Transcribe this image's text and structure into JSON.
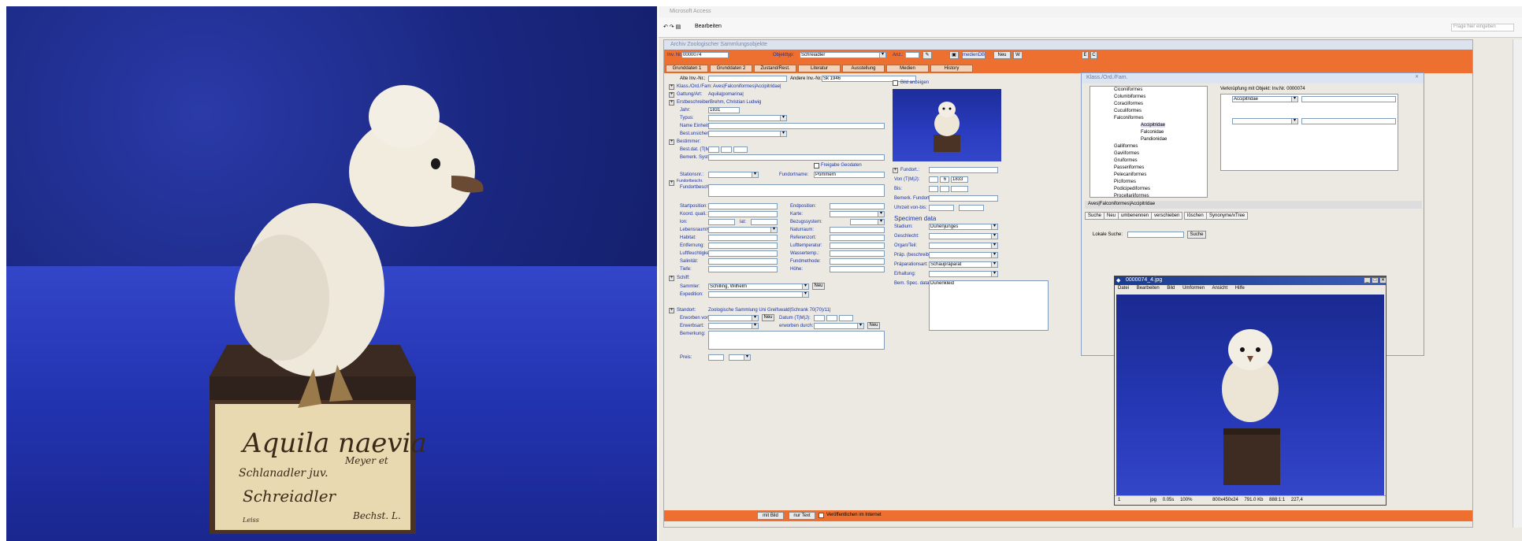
{
  "left_photo": {
    "label_line1": "Aquila naevia",
    "label_line2": "Meyer et",
    "label_line3": "Schlanadler juv.",
    "label_line4": "Schreiadler",
    "label_line5": "Leiss",
    "label_line6": "Bechst. L."
  },
  "app": {
    "title": "Microsoft Access",
    "ribbon_label": "Bearbeiten",
    "help_search": "Frage hier eingeben",
    "form_title": "Archiv Zoologischer Sammlungsobjekte",
    "header": {
      "inv_label": "Inv. Nr.:",
      "inv_value": "0000074",
      "objekttyp_label": "Objekttyp:",
      "objekttyp_value": "Schreiadler",
      "anz_label": "Anz.:",
      "medien_btn": "medienDB",
      "neu_btn": "Neu",
      "small_btn": "W",
      "e_btn": "E",
      "c_btn": "C"
    },
    "tabs": [
      "Grunddaten 1",
      "Grunddaten 2",
      "Zustand/Rest.",
      "Literatur",
      "Ausstellung",
      "Medien",
      "History"
    ],
    "fields": {
      "alte_inv": "Alte Inv.-Nr.:",
      "andere_inv": "Andere Inv.-Nr.:",
      "andere_inv_value": "Sk 1946",
      "klass": "Klass./Ord./Fam:",
      "klass_value": "Aves|Falconiformes|Accipitridae|",
      "gattung": "Gattung/Art:",
      "gattung_value": "Aquila|pomarina|",
      "erstbeschreiber": "Erstbeschreiber:",
      "erstbeschreiber_value": "Brehm, Christian Ludwig",
      "jahr": "Jahr:",
      "jahr_value": "1831",
      "typus": "Typus:",
      "name_einheit": "Name Einheit:",
      "best_unsicher": "Best.unsicher:",
      "bestimmer": "Bestimmer:",
      "best_dat": "Best.dat. (T|M|J):",
      "bemerk_syst": "Bemerk. Syst.:",
      "freigabe": "Freigabe Geodaten",
      "stationsnr": "Stationsnr.:",
      "fundortname": "Fundortname:",
      "fundortname_value": "Pommern",
      "fundortbeschr": "Fundortbeschr.:",
      "fundortbeschr_head": "Fundortbeschr.",
      "startposition": "Startposition:",
      "endposition": "Endposition:",
      "koord": "Koord. quali.:",
      "karte": "Karte:",
      "lon": "lon:",
      "lat": "lat:",
      "bezugssystem": "Bezugssystem:",
      "lebensraum": "Lebensraumtyp:",
      "naturraum": "Naturraum:",
      "habitat": "Habitat:",
      "referenzort": "Referenzort:",
      "entfernung": "Entfernung:",
      "lufttemp": "Lufttemperatur:",
      "luftfeuchte": "Luftfeuchtigkeit:",
      "wassertemp": "Wassertemp.:",
      "salinitaet": "Salinität:",
      "fundmethode": "Fundmethode:",
      "tiefe": "Tiefe:",
      "hoehe": "Höhe:",
      "schiff": "Schiff:",
      "sammler": "Sammler:",
      "sammler_value": "Schilling, Wilhelm",
      "expedition": "Expedition:",
      "standort": "Standort:",
      "standort_value": "Zoologische Sammlung Uni Greifswald|Schrank 70(70)/11|",
      "erworben_von": "Erworben von:",
      "datum": "Datum (T|M|J):",
      "erwerbsart": "Erwerbsart:",
      "erworben_durch": "erworben durch:",
      "bemerkung": "Bemerkung:",
      "preis": "Preis:",
      "neu": "Neu",
      "bild_anzeigen": "Bild anzeigen",
      "fundort": "Fundort.:",
      "von": "Von (T|M|J):",
      "von_m": "6",
      "von_j": "1833",
      "bis": "Bis:",
      "bemerk_fundort": "Bemerk. Fundort.:",
      "uhrzeit": "Uhrzeit von-bis:",
      "specimen_data": "Specimen data",
      "stadium": "Stadium:",
      "stadium_value": "Dunenjunges",
      "geschlecht": "Geschlecht:",
      "organ": "Organ/Teil:",
      "praep_beschr": "Präp. (beschreib.):",
      "praeparationsart": "Präparationsart:",
      "praeparationsart_value": "Schaupräparat",
      "erhaltung": "Erhaltung:",
      "bem_spec": "Bem. Spec. data:",
      "bem_spec_value": "Dunenkleid"
    },
    "bottom": {
      "mit_bild": "mit Bild",
      "nur_text": "nur Text",
      "veroeffentlichen": "Veröffentlichen im Internet"
    }
  },
  "tree_window": {
    "title": "Klass./Ord./Fam.",
    "link_label": "Verknüpfung mit Objekt: Inv.Nr. 0000074",
    "link_value": "Accipitridae",
    "nodes": [
      "Ciconiiformes",
      "Columbiformes",
      "Coraciiformes",
      "Cuculiformes",
      "Falconiformes",
      "Accipitridae",
      "Falconidae",
      "Pandionidae",
      "Galliformes",
      "Gaviiformes",
      "Gruiformes",
      "Passeriformes",
      "Pelecaniformes",
      "Piciformes",
      "Podicipediformes",
      "Procellariiformes"
    ],
    "path": "Aves|Falconiformes|Accipitridae",
    "tabs": [
      "Suche",
      "Neu",
      "umbenennen",
      "verschieben",
      "löschen",
      "Synonyme/xTree"
    ],
    "lokale_suche": "Lokale Suche:",
    "suche_btn": "Suche"
  },
  "viewer": {
    "title": "0000074_4.jpg",
    "menu": [
      "Datei",
      "Bearbeiten",
      "Bild",
      "Umformen",
      "Ansicht",
      "Hilfe"
    ],
    "status": [
      "1",
      "jpg",
      "0.05s",
      "100%",
      "800x450x24",
      "791.0 Kb",
      "888:1:1",
      "227,4"
    ]
  },
  "colors": {
    "orange": "#ee7030",
    "form_bg": "#ece9e3",
    "photo_blue": "#2233b0",
    "label_blue": "#1a34a0"
  }
}
